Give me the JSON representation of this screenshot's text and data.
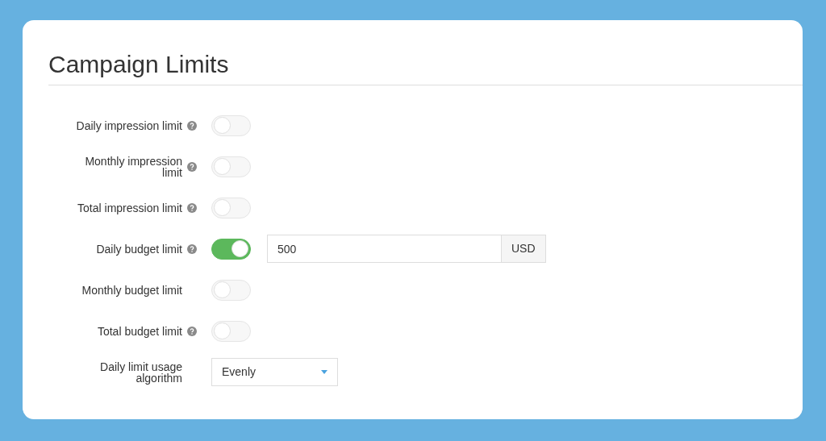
{
  "title": "Campaign Limits",
  "rows": [
    {
      "kind": "toggle",
      "label": "Daily impression limit",
      "help": true,
      "on": false
    },
    {
      "kind": "toggle",
      "label": "Monthly impression limit",
      "help": true,
      "on": false
    },
    {
      "kind": "toggle",
      "label": "Total impression limit",
      "help": true,
      "on": false
    },
    {
      "kind": "toggle",
      "label": "Daily budget limit",
      "help": true,
      "on": true,
      "value": "500",
      "addon": "USD"
    },
    {
      "kind": "toggle",
      "label": "Monthly budget limit",
      "help": false,
      "on": false
    },
    {
      "kind": "toggle",
      "label": "Total budget limit",
      "help": true,
      "on": false
    },
    {
      "kind": "select",
      "label": "Daily limit usage algorithm",
      "help": false,
      "value": "Evenly"
    }
  ]
}
